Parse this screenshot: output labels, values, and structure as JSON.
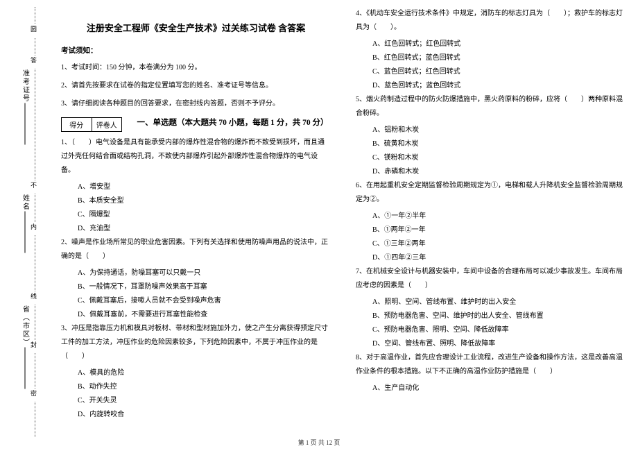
{
  "title": "注册安全工程师《安全生产技术》过关练习试卷 含答案",
  "notice": {
    "head": "考试须知：",
    "items": [
      "1、考试时间：150 分钟，本卷满分为 100 分。",
      "2、请首先按要求在试卷的指定位置填写您的姓名、准考证号等信息。",
      "3、请仔细阅读各种题目的回答要求，在密封线内答题，否则不予评分。"
    ]
  },
  "scorebox": {
    "c1": "得分",
    "c2": "评卷人"
  },
  "section1_head": "一、单选题（本大题共 70 小题，每题 1 分，共 70 分）",
  "q1": {
    "stem": "1、（　　）电气设备是具有能承受内部的爆炸性混合物的爆炸而不致受到损坏，而且通过外壳任何结合面或结构孔洞，不致使内部爆炸引起外部爆炸性混合物爆炸的电气设备。",
    "A": "A、增安型",
    "B": "B、本质安全型",
    "C": "C、隔爆型",
    "D": "D、充油型"
  },
  "q2": {
    "stem": "2、噪声是作业场所常见的职业危害因素。下列有关选择和使用防噪声用品的说法中，正确的是（　　）",
    "A": "A、为保持通话，防噪耳塞可以只戴一只",
    "B": "B、一般情况下，耳罩防噪声效果高于耳塞",
    "C": "C、佩戴耳塞后，接嗽人员就不会受到噪声危害",
    "D": "D、佩戴耳塞前，不需要进行耳塞性能检查"
  },
  "q3": {
    "stem": "3、冲压是指靠压力机和模具对板材、带材和型材施加外力，使之产生分离获得预定尺寸工件的加工方法，冲压作业的危险因素较多，下列危险因素中，不属于冲压作业的是（　　）",
    "A": "A、模具的危险",
    "B": "B、动作失控",
    "C": "C、开关失灵",
    "D": "D、内旋转咬合"
  },
  "q4": {
    "stem": "4、《机动车安全运行技术条件》中规定，消防车的标志灯具为（　　）；救护车的标志灯具为（　　）。",
    "A": "A、红色回转式；红色回转式",
    "B": "B、红色回转式；蓝色回转式",
    "C": "C、蓝色回转式；红色回转式",
    "D": "D、蓝色回转式；蓝色回转式"
  },
  "q5": {
    "stem": "5、烟火药制造过程中的防火防爆措施中，黑火药原料的粉碎，应将（　　）两种原料混合粉碎。",
    "A": "A、铝粉和木炭",
    "B": "B、硫黄和木炭",
    "C": "C、镁粉和木炭",
    "D": "D、赤磷和木炭"
  },
  "q6": {
    "stem": "6、在用起重机安全定期监督检验周期规定为①，电梯和载人升降机安全监督检验周期规定为②。",
    "A": "A、①一年②半年",
    "B": "B、①两年②一年",
    "C": "C、①三年②两年",
    "D": "D、①四年②三年"
  },
  "q7": {
    "stem": "7、在机械安全设计与机器安装中，车间中设备的合理布局可以减少事故发生。车间布局应考虑的因素是（　　）",
    "A": "A、照明、空间、管线布置、维护时的出入安全",
    "B": "B、预防电器危害、空间、维护时的出人安全、管线布置",
    "C": "C、预防电器危害、照明、空间、降低故障率",
    "D": "D、空间、管线布置、照明、降低故障率"
  },
  "q8": {
    "stem": "8、对于高温作业，首先应合理设计工业流程，改进生产设备和操作方法，这是改善高温作业条件的根本措施。以下不正确的高温作业防护措施是（　　）",
    "A": "A、生产自动化"
  },
  "sidebar": {
    "vlabels": [
      "圆",
      "答",
      "准",
      "不",
      "内",
      "线",
      "封",
      "密"
    ],
    "fields": {
      "f1": "准考证号",
      "f2": "姓名",
      "f3": "省（市区）"
    }
  },
  "footer": "第 1 页 共 12 页"
}
